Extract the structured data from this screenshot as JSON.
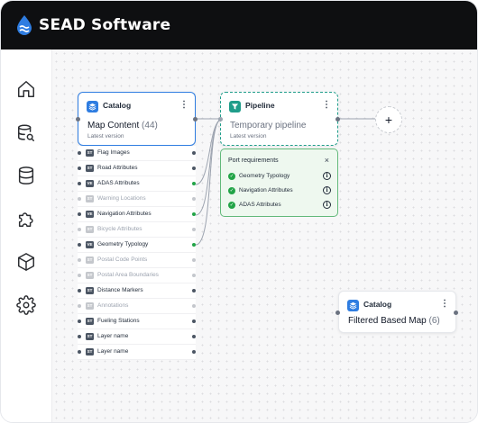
{
  "brand": {
    "name": "SEAD Software",
    "accent": "#2f7de1"
  },
  "sidebar": {
    "items": [
      {
        "name": "home-icon"
      },
      {
        "name": "database-search-icon"
      },
      {
        "name": "database-icon"
      },
      {
        "name": "puzzle-icon"
      },
      {
        "name": "cube-icon"
      },
      {
        "name": "gear-icon"
      }
    ]
  },
  "catalog_node": {
    "type_label": "Catalog",
    "title": "Map Content",
    "count": "(44)",
    "version": "Latest version"
  },
  "pipeline_node": {
    "type_label": "Pipeline",
    "title": "Temporary pipeline",
    "version": "Latest version"
  },
  "filtered_node": {
    "type_label": "Catalog",
    "title": "Filtered Based Map",
    "count": "(6)"
  },
  "attributes": [
    {
      "badge": "ST",
      "name": "Flag Images",
      "active": true,
      "connected": false
    },
    {
      "badge": "ST",
      "name": "Road Attributes",
      "active": true,
      "connected": false
    },
    {
      "badge": "VE",
      "name": "ADAS Attributes",
      "active": true,
      "connected": true
    },
    {
      "badge": "ST",
      "name": "Warning Locations",
      "active": false,
      "connected": false
    },
    {
      "badge": "VE",
      "name": "Navigation Attributes",
      "active": true,
      "connected": true
    },
    {
      "badge": "ST",
      "name": "Bicycle Attributes",
      "active": false,
      "connected": false
    },
    {
      "badge": "VE",
      "name": "Geometry Typology",
      "active": true,
      "connected": true
    },
    {
      "badge": "ST",
      "name": "Postal Code Points",
      "active": false,
      "connected": false
    },
    {
      "badge": "ST",
      "name": "Postal Area Boundaries",
      "active": false,
      "connected": false
    },
    {
      "badge": "ST",
      "name": "Distance Markers",
      "active": true,
      "connected": false
    },
    {
      "badge": "ST",
      "name": "Annotations",
      "active": false,
      "connected": false
    },
    {
      "badge": "ST",
      "name": "Fueling Stations",
      "active": true,
      "connected": false
    },
    {
      "badge": "ST",
      "name": "Layer name",
      "active": true,
      "connected": false
    },
    {
      "badge": "ST",
      "name": "Layer name",
      "active": true,
      "connected": false
    }
  ],
  "requirements": {
    "title": "Port requirements",
    "close": "×",
    "items": [
      "Geometry Typology",
      "Navigation Attributes",
      "ADAS Attributes"
    ]
  },
  "add_button": {
    "label": "+"
  },
  "colors": {
    "catalog_border": "#2f7de1",
    "pipeline_border": "#1f9d8a",
    "success": "#22a447"
  }
}
